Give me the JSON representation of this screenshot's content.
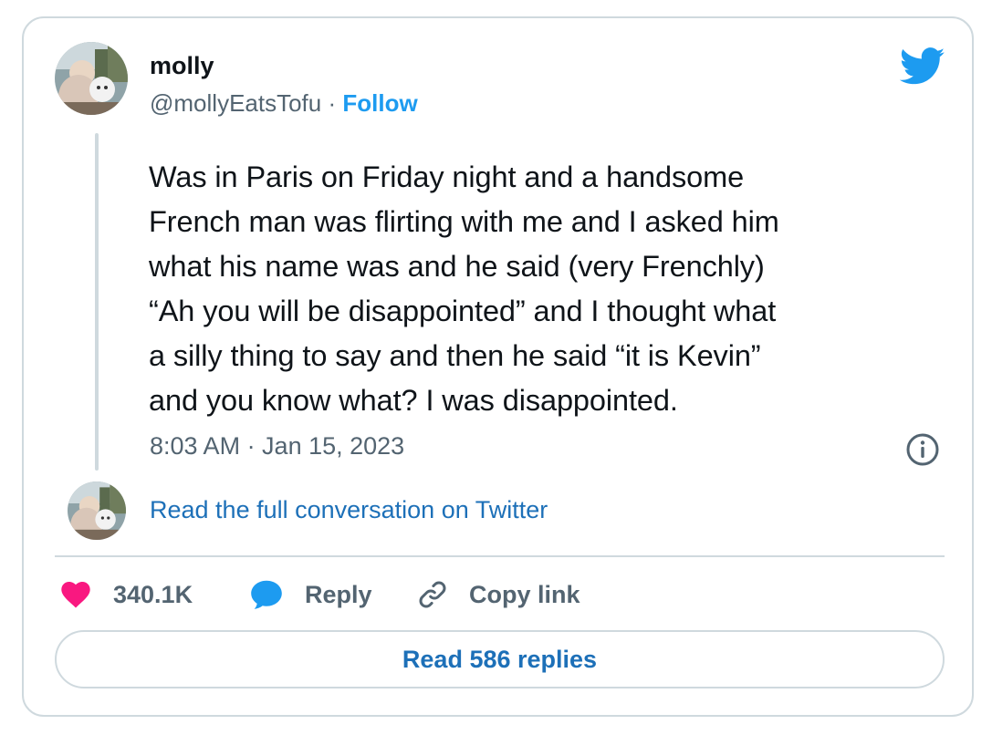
{
  "author": {
    "name": "molly",
    "handle": "@mollyEatsTofu",
    "separator": "·",
    "follow_label": "Follow",
    "avatar_icon": "user-avatar-photo"
  },
  "tweet": {
    "text": "Was in Paris on Friday night and a handsome\nFrench man was flirting with me and I asked him\nwhat his name was and he said (very Frenchly)\n“Ah you will be disappointed” and I thought what\na silly thing to say and then he said “it is Kevin”\nand you know what? I was disappointed.",
    "timestamp": "8:03 AM · Jan 15, 2023"
  },
  "conversation": {
    "read_full_label": "Read the full conversation on Twitter"
  },
  "actions": {
    "likes_count": "340.1K",
    "reply_label": "Reply",
    "copy_link_label": "Copy link"
  },
  "replies_button": {
    "label": "Read 586 replies"
  },
  "icons": {
    "brand": "twitter-bird-icon",
    "info": "info-icon",
    "like": "heart-icon",
    "reply": "speech-bubble-icon",
    "copy": "link-icon"
  },
  "colors": {
    "brand_blue": "#1d9bf0",
    "link_blue": "#1d70b8",
    "heart_pink": "#f91880",
    "muted_text": "#536471",
    "border": "#cfd9de"
  }
}
